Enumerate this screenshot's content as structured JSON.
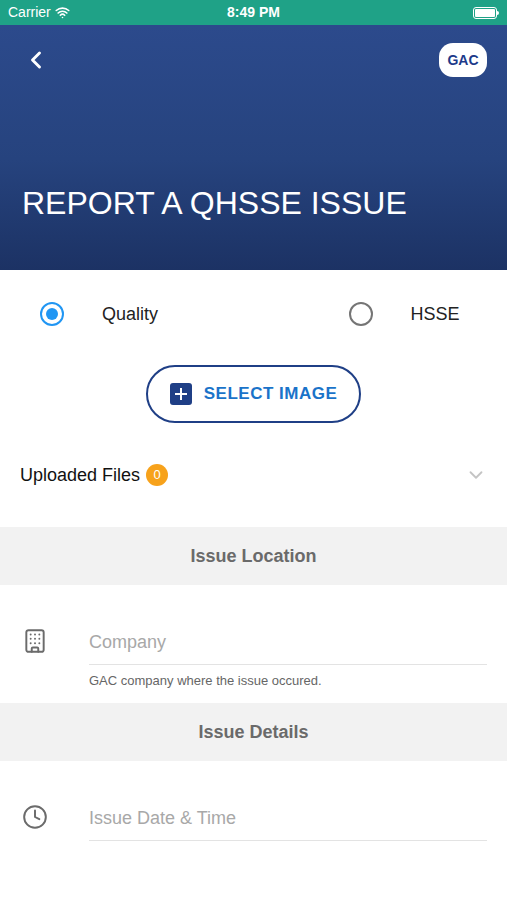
{
  "status_bar": {
    "carrier": "Carrier",
    "time": "8:49 PM"
  },
  "header": {
    "title": "REPORT A QHSSE ISSUE",
    "logo": "GAC"
  },
  "issue_types": [
    {
      "label": "Quality",
      "selected": true
    },
    {
      "label": "HSSE",
      "selected": false
    }
  ],
  "select_image_button": "SELECT IMAGE",
  "uploaded_files": {
    "label": "Uploaded Files",
    "count": "0",
    "expanded": false
  },
  "sections": [
    {
      "title": "Issue Location",
      "fields": [
        {
          "kind": "company",
          "placeholder": "Company",
          "helper": "GAC company where the issue occured."
        }
      ]
    },
    {
      "title": "Issue Details",
      "fields": [
        {
          "kind": "datetime",
          "placeholder": "Issue Date & Time"
        }
      ]
    }
  ]
}
